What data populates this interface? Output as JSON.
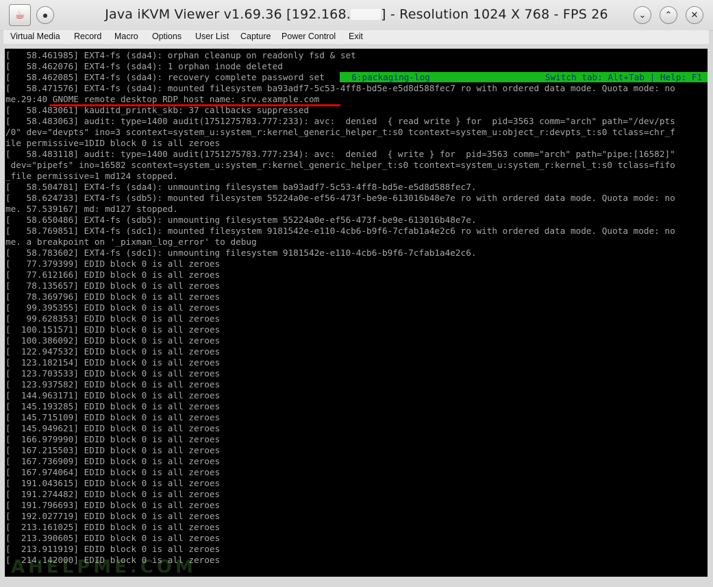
{
  "window": {
    "title_before": "Java iKVM Viewer v1.69.36 [192.168.",
    "title_after": "] - Resolution 1024 X 768 - FPS 26"
  },
  "menu": [
    "Virtual Media",
    "Record",
    "Macro",
    "Options",
    "User List",
    "Capture",
    "Power Control",
    "Exit"
  ],
  "status_bar": {
    "left": "  6:packaging-log",
    "right": "Switch tab: Alt+Tab | Help: F1"
  },
  "console_lines": [
    "[   58.461985] EXT4-fs (sda4): orphan cleanup on readonly fsd & set",
    "[   58.462076] EXT4-fs (sda4): 1 orphan inode deleted",
    "[   58.462085] EXT4-fs (sda4): recovery complete password set",
    "[   58.471576] EXT4-fs (sda4): mounted filesystem ba93adf7-5c53-4ff8-bd5e-e5d8d588fec7 ro with ordered data mode. Quota mode: no",
    "me.29:40 GNOME remote desktop RDP host name: srv.example.com",
    "[   58.483061] kauditd_printk_skb: 37 callbacks suppressed",
    "[   58.483063] audit: type=1400 audit(1751275783.777:233): avc:  denied  { read write } for  pid=3563 comm=\"arch\" path=\"/dev/pts",
    "/0\" dev=\"devpts\" ino=3 scontext=system_u:system_r:kernel_generic_helper_t:s0 tcontext=system_u:object_r:devpts_t:s0 tclass=chr_f",
    "ile permissive=1DID block 0 is all zeroes",
    "[   58.483118] audit: type=1400 audit(1751275783.777:234): avc:  denied  { write } for  pid=3563 comm=\"arch\" path=\"pipe:[16582]\"",
    " dev=\"pipefs\" ino=16582 scontext=system_u:system_r:kernel_generic_helper_t:s0 tcontext=system_u:system_r:kernel_t:s0 tclass=fifo",
    "_file permissive=1 md124 stopped.",
    "[   58.504781] EXT4-fs (sda4): unmounting filesystem ba93adf7-5c53-4ff8-bd5e-e5d8d588fec7.",
    "[   58.624733] EXT4-fs (sdb5): mounted filesystem 55224a0e-ef56-473f-be9e-613016b48e7e ro with ordered data mode. Quota mode: no",
    "me. 57.539167] md: md127 stopped.",
    "[   58.650486] EXT4-fs (sdb5): unmounting filesystem 55224a0e-ef56-473f-be9e-613016b48e7e.",
    "[   58.769851] EXT4-fs (sdc1): mounted filesystem 9181542e-e110-4cb6-b9f6-7cfab1a4e2c6 ro with ordered data mode. Quota mode: no",
    "me. a breakpoint on '_pixman_log_error' to debug",
    "[   58.783602] EXT4-fs (sdc1): unmounting filesystem 9181542e-e110-4cb6-b9f6-7cfab1a4e2c6.",
    "[   77.379399] EDID block 0 is all zeroes",
    "[   77.612166] EDID block 0 is all zeroes",
    "[   78.135657] EDID block 0 is all zeroes",
    "[   78.369796] EDID block 0 is all zeroes",
    "[   99.395355] EDID block 0 is all zeroes",
    "[   99.628353] EDID block 0 is all zeroes",
    "[  100.151571] EDID block 0 is all zeroes",
    "[  100.386092] EDID block 0 is all zeroes",
    "[  122.947532] EDID block 0 is all zeroes",
    "[  123.182154] EDID block 0 is all zeroes",
    "[  123.703533] EDID block 0 is all zeroes",
    "[  123.937582] EDID block 0 is all zeroes",
    "[  144.963171] EDID block 0 is all zeroes",
    "[  145.193285] EDID block 0 is all zeroes",
    "[  145.715109] EDID block 0 is all zeroes",
    "[  145.949621] EDID block 0 is all zeroes",
    "[  166.979990] EDID block 0 is all zeroes",
    "[  167.215503] EDID block 0 is all zeroes",
    "[  167.736909] EDID block 0 is all zeroes",
    "[  167.974064] EDID block 0 is all zeroes",
    "[  191.043615] EDID block 0 is all zeroes",
    "[  191.274482] EDID block 0 is all zeroes",
    "[  191.796693] EDID block 0 is all zeroes",
    "[  192.027719] EDID block 0 is all zeroes",
    "[  213.161025] EDID block 0 is all zeroes",
    "[  213.390605] EDID block 0 is all zeroes",
    "[  213.911919] EDID block 0 is all zeroes",
    "[  214.142000] EDID block 0 is all zeroes"
  ],
  "watermark": "AHELPME.COM",
  "colors": {
    "console_bg": "#000000",
    "console_text": "#a8a8a8",
    "status_bar_bg": "#15b81c",
    "status_bar_text": "#003a6b",
    "highlight_underline": "#e60000"
  }
}
